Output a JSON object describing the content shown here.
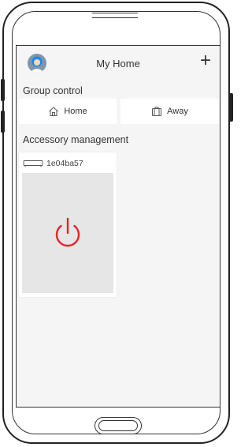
{
  "header": {
    "title": "My Home",
    "add_label": "+"
  },
  "group_control": {
    "label": "Group control",
    "buttons": [
      {
        "label": "Home",
        "icon": "home-icon"
      },
      {
        "label": "Away",
        "icon": "suitcase-icon"
      }
    ]
  },
  "accessory_management": {
    "label": "Accessory management",
    "devices": [
      {
        "name": "1e04ba57",
        "icon": "device-icon",
        "power_icon": "power-icon",
        "power_color": "#e8222a"
      }
    ]
  },
  "colors": {
    "screen_bg": "#f5f5f5",
    "card_bg": "#ffffff",
    "tile_bg": "#e6e6e6",
    "power": "#e8222a",
    "avatar_blue": "#1e88e5"
  }
}
